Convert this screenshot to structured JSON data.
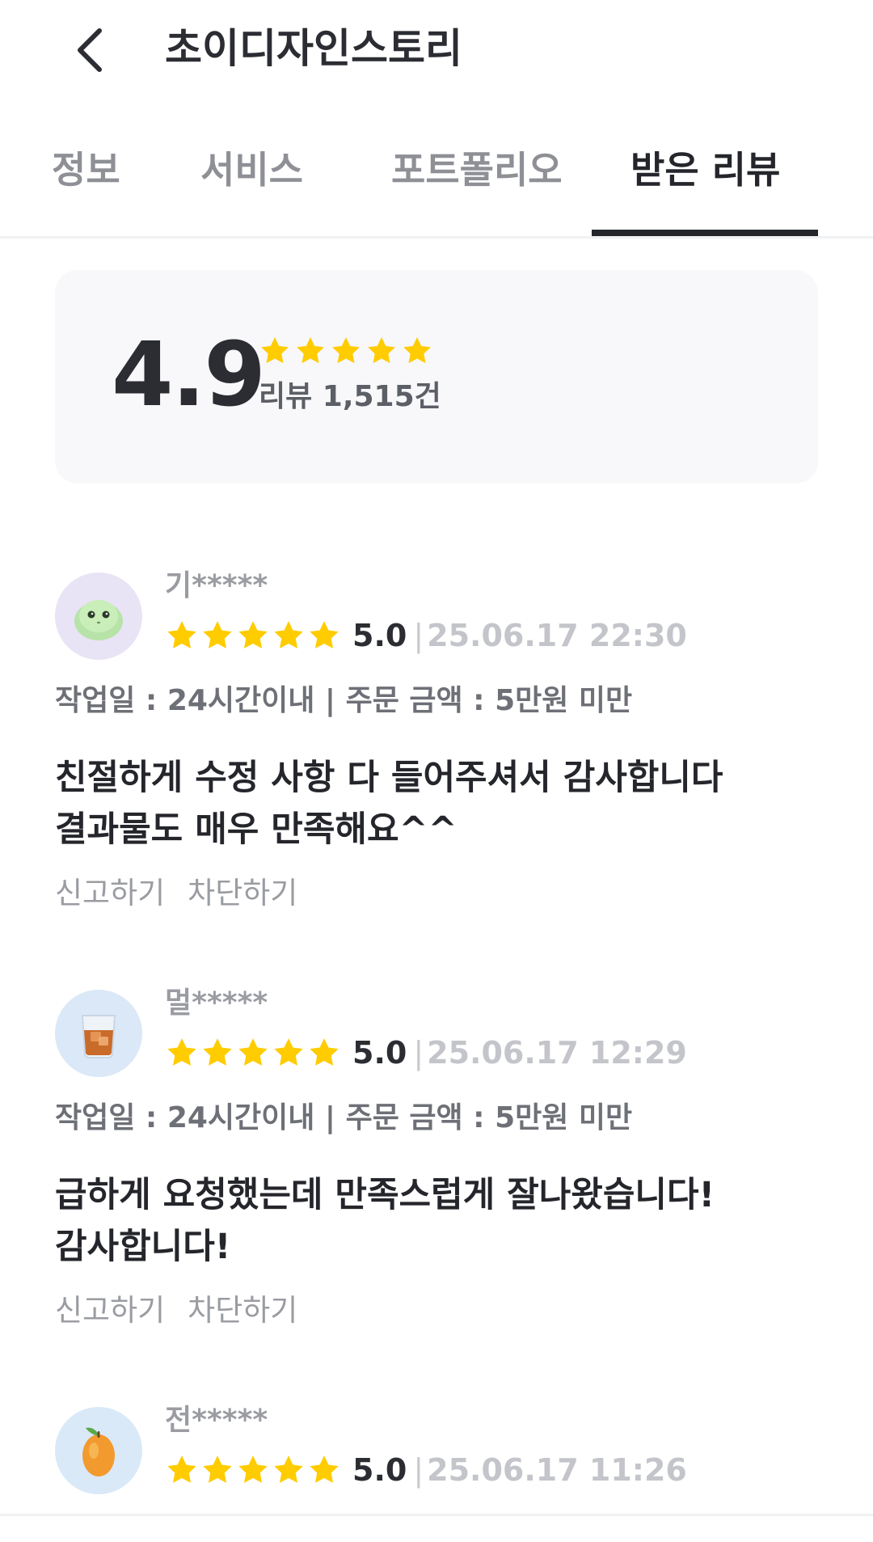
{
  "header": {
    "title": "초이디자인스토리",
    "back_icon": "chevron-left-icon"
  },
  "tabs": [
    {
      "label": "정보",
      "active": false
    },
    {
      "label": "서비스",
      "active": false
    },
    {
      "label": "포트폴리오",
      "active": false
    },
    {
      "label": "받은 리뷰",
      "active": true
    }
  ],
  "summary": {
    "average": "4.9",
    "stars": 5,
    "count_text": "리뷰 1,515건"
  },
  "reviews": [
    {
      "avatar": "turtle-avatar",
      "avatar_bg": "#e9e3f6",
      "username": "기*****",
      "score": "5.0",
      "separator": "|",
      "date": "25.06.17 22:30",
      "meta": "작업일 : 24시간이내 | 주문 금액 : 5만원 미만",
      "lines": [
        "친절하게 수정 사항 다 들어주셔서 감사합니다",
        "결과물도 매우 만족해요^^"
      ],
      "report": "신고하기",
      "block": "차단하기"
    },
    {
      "avatar": "whiskey-glass-avatar",
      "avatar_bg": "#dbe8f7",
      "username": "멀*****",
      "score": "5.0",
      "separator": "|",
      "date": "25.06.17 12:29",
      "meta": "작업일 : 24시간이내 | 주문 금액 : 5만원 미만",
      "lines": [
        "급하게 요청했는데 만족스럽게 잘나왔습니다!",
        "감사합니다!"
      ],
      "report": "신고하기",
      "block": "차단하기"
    },
    {
      "avatar": "mango-avatar",
      "avatar_bg": "#d9e9f8",
      "username": "전*****",
      "score": "5.0",
      "separator": "|",
      "date": "25.06.17 11:26"
    }
  ],
  "colors": {
    "star": "#ffcc00",
    "active_tab": "#24262b",
    "inactive_tab": "#8e9096",
    "card_bg": "#f8f8fa"
  }
}
